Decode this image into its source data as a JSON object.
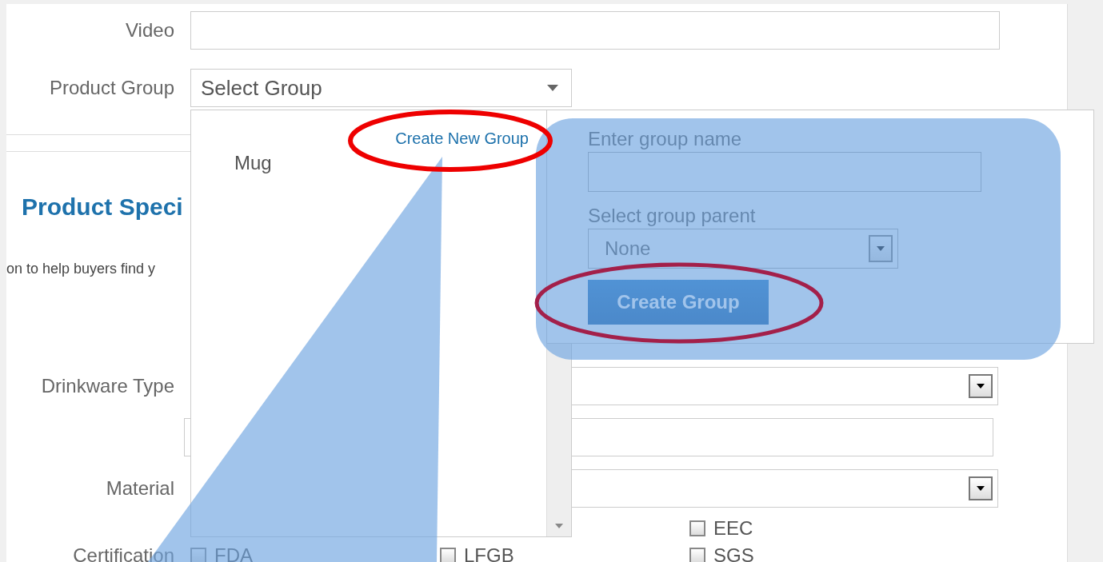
{
  "top_fields": [
    {
      "label": "Video",
      "kind": "text"
    },
    {
      "label": "Product Group",
      "kind": "select",
      "value": "Select Group"
    }
  ],
  "group_dropdown": {
    "options": [
      {
        "label": "Mug",
        "selected": false
      }
    ],
    "create_link": "Create New Group"
  },
  "create_group_popup": {
    "name_label": "Enter group name",
    "parent_label": "Select group parent",
    "parent_value": "None",
    "button": "Create Group"
  },
  "specifications": {
    "heading": "Product Speci",
    "description": "on to help buyers find y",
    "fields": [
      {
        "label": "Drinkware Type",
        "kind": "select"
      },
      {
        "kind": "text"
      },
      {
        "label": "Material",
        "kind": "select"
      }
    ],
    "certification": {
      "label": "Certification",
      "rows": [
        [
          null,
          null,
          {
            "label": "EEC",
            "checked": false
          }
        ],
        [
          {
            "label": "FDA",
            "checked": false
          },
          {
            "label": "LFGB",
            "checked": false
          },
          {
            "label": "SGS",
            "checked": false
          }
        ]
      ]
    }
  }
}
